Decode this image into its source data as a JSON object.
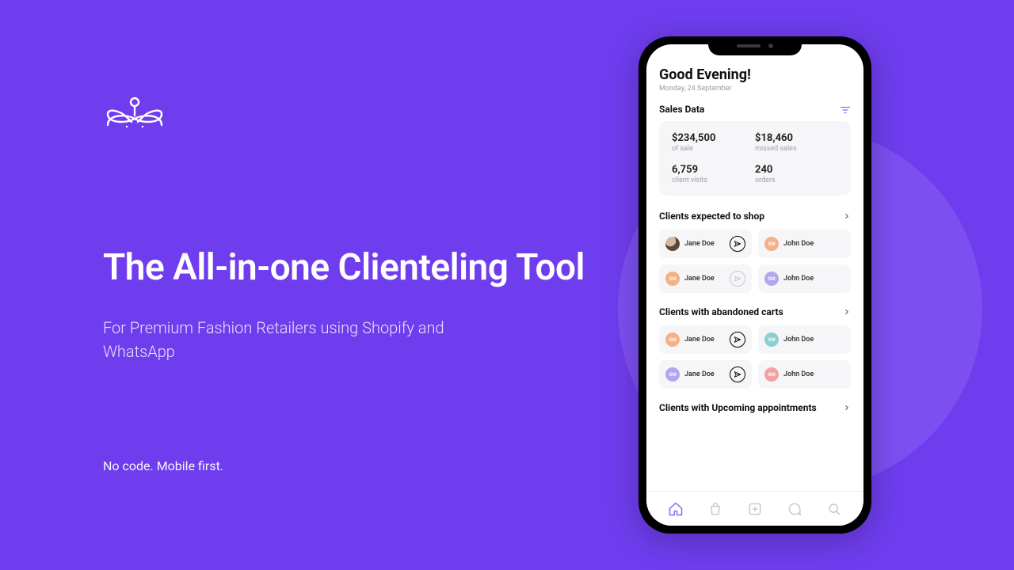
{
  "marketing": {
    "headline": "The All-in-one Clienteling Tool",
    "subhead": "For Premium Fashion Retailers using Shopify and WhatsApp",
    "tagline": "No code. Mobile first."
  },
  "app": {
    "greeting": "Good Evening!",
    "date": "Monday,  24 September",
    "sales_section_title": "Sales Data",
    "stats": [
      {
        "value": "$234,500",
        "label": "of sale"
      },
      {
        "value": "$18,460",
        "label": "missed sales"
      },
      {
        "value": "6,759",
        "label": "client visits"
      },
      {
        "value": "240",
        "label": "orders"
      }
    ],
    "lists": [
      {
        "title": "Clients expected to shop",
        "clients": [
          {
            "name": "Jane Doe",
            "avatar": "photo",
            "initials": "",
            "send": "active"
          },
          {
            "name": "John Doe",
            "avatar": "orange",
            "initials": "SM",
            "send": "none"
          },
          {
            "name": "Jane Doe",
            "avatar": "orange",
            "initials": "SM",
            "send": "disabled"
          },
          {
            "name": "John Doe",
            "avatar": "purple",
            "initials": "SM",
            "send": "none"
          }
        ]
      },
      {
        "title": "Clients with abandoned carts",
        "clients": [
          {
            "name": "Jane Doe",
            "avatar": "orange",
            "initials": "SM",
            "send": "active"
          },
          {
            "name": "John Doe",
            "avatar": "teal",
            "initials": "SM",
            "send": "none"
          },
          {
            "name": "Jane Doe",
            "avatar": "purple",
            "initials": "SM",
            "send": "active"
          },
          {
            "name": "John Doe",
            "avatar": "pink",
            "initials": "SM",
            "send": "none"
          }
        ]
      },
      {
        "title": "Clients with Upcoming appointments",
        "clients": []
      }
    ],
    "tabs": [
      "home",
      "bag",
      "add",
      "whatsapp",
      "search"
    ]
  }
}
